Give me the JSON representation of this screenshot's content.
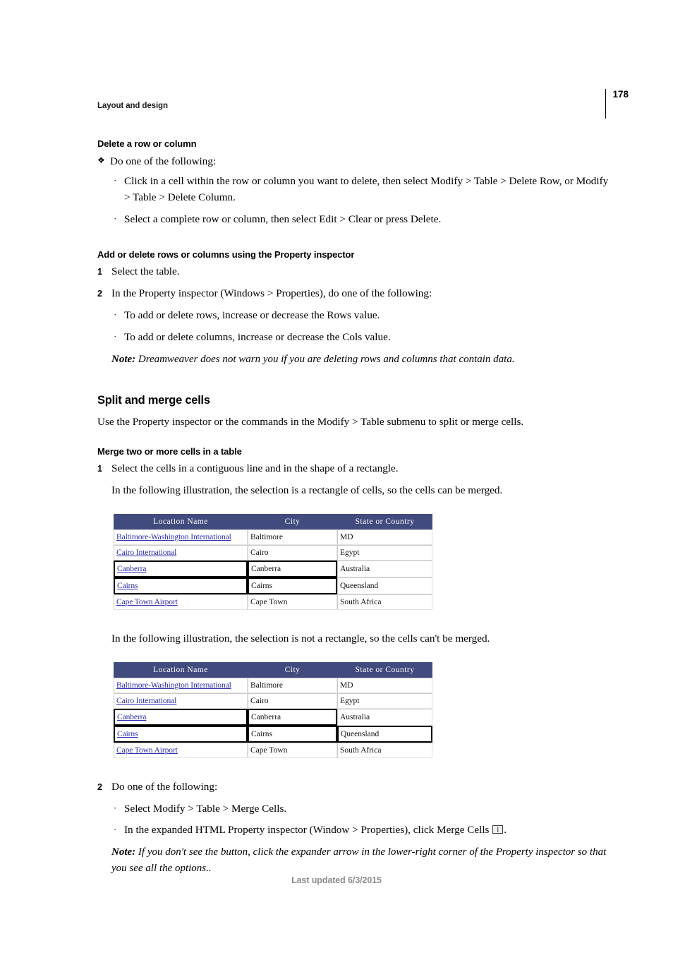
{
  "header": {
    "running_title": "Layout and design",
    "page_number": "178"
  },
  "footer": {
    "text": "Last updated 6/3/2015"
  },
  "sections": {
    "delete_row_column": {
      "heading": "Delete a row or column",
      "action_intro": "Do one of the following:",
      "bullets": [
        "Click in a cell within the row or column you want to delete, then select Modify > Table > Delete Row, or Modify > Table > Delete Column.",
        "Select a complete row or column, then select Edit > Clear or press Delete."
      ]
    },
    "add_delete_property_inspector": {
      "heading": "Add or delete rows or columns using the Property inspector",
      "steps": [
        {
          "num": "1",
          "text": "Select the table."
        },
        {
          "num": "2",
          "text": "In the Property inspector (Windows > Properties), do one of the following:"
        }
      ],
      "bullets": [
        "To add or delete rows, increase or decrease the Rows value.",
        "To add or delete columns, increase or decrease the Cols value."
      ],
      "note_label": "Note:",
      "note_text": " Dreamweaver does not warn you if you are deleting rows and columns that contain data."
    },
    "split_and_merge": {
      "heading": "Split and merge cells",
      "intro": "Use the Property inspector or the commands in the Modify > Table submenu to split or merge cells."
    },
    "merge_two_or_more": {
      "heading": "Merge two or more cells in a table",
      "step1": {
        "num": "1",
        "text": "Select the cells in a contiguous line and in the shape of a rectangle."
      },
      "caption_rectangle": "In the following illustration, the selection is a rectangle of cells, so the cells can be merged.",
      "caption_not_rectangle": "In the following illustration, the selection is not a rectangle, so the cells can't be merged.",
      "step2": {
        "num": "2",
        "text": "Do one of the following:"
      },
      "bullet1": "Select Modify > Table > Merge Cells.",
      "bullet2_before": "In the expanded HTML Property inspector (Window > Properties), click Merge Cells",
      "bullet2_after": ".",
      "note_label": "Note:",
      "note_text": "  If you don't see the button, click the expander arrow in the lower-right corner of the Property inspector so that you see all the options.."
    }
  },
  "illustration_table": {
    "headers": [
      "Location Name",
      "City",
      "State or Country"
    ],
    "rows": [
      {
        "location": "Baltimore-Washington International",
        "city": "Baltimore",
        "state": "MD"
      },
      {
        "location": "Cairo International",
        "city": "Cairo",
        "state": "Egypt"
      },
      {
        "location": "Canberra",
        "city": "Canberra",
        "state": "Australia"
      },
      {
        "location": "Cairns",
        "city": "Cairns",
        "state": "Queensland"
      },
      {
        "location": "Cape Town Airport",
        "city": "Cape Town",
        "state": "South Africa"
      }
    ],
    "selection_rectangle": [
      "r2c0",
      "r2c1",
      "r3c0",
      "r3c1"
    ],
    "selection_not_rectangle": [
      "r2c0",
      "r2c1",
      "r3c0",
      "r3c1",
      "r3c2"
    ],
    "colors": {
      "header_bg": "#414b7d",
      "header_text": "#ffffff",
      "link": "#2d2dad",
      "cell_border": "#c9c9c9",
      "selection_border": "#000000"
    }
  }
}
